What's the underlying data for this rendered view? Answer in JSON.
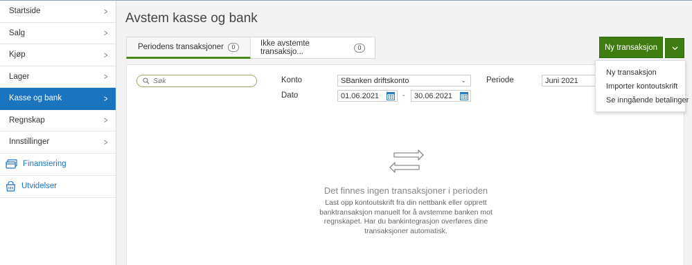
{
  "sidebar": {
    "items": [
      {
        "label": "Startside"
      },
      {
        "label": "Salg"
      },
      {
        "label": "Kjøp"
      },
      {
        "label": "Lager"
      },
      {
        "label": "Kasse og bank"
      },
      {
        "label": "Regnskap"
      },
      {
        "label": "Innstillinger"
      }
    ],
    "special": [
      {
        "label": "Finansiering",
        "icon": "card-stack-icon"
      },
      {
        "label": "Utvidelser",
        "icon": "basket-icon"
      }
    ]
  },
  "page": {
    "title": "Avstem kasse og bank"
  },
  "tabs": [
    {
      "label": "Periodens transaksjoner",
      "count": "0"
    },
    {
      "label": "Ikke avstemte transaksjo...",
      "count": "0"
    }
  ],
  "filters": {
    "search_placeholder": "Søk",
    "konto_label": "Konto",
    "konto_value": "SBanken driftskonto",
    "periode_label": "Periode",
    "periode_value": "Juni 2021",
    "dato_label": "Dato",
    "date_from": "01.06.2021",
    "date_separator": "-",
    "date_to": "30.06.2021"
  },
  "empty_state": {
    "title": "Det finnes ingen transaksjoner i perioden",
    "text": "Last opp kontoutskrift fra din nettbank eller opprett banktransaksjon manuelt for å avstemme banken mot regnskapet. Har du bankintegrasjon overføres dine transaksjoner automatisk."
  },
  "actions": {
    "primary_label": "Ny transaksjon",
    "menu": [
      {
        "label": "Ny transaksjon"
      },
      {
        "label": "Importer kontoutskrift"
      },
      {
        "label": "Se inngående betalinger"
      }
    ]
  },
  "colors": {
    "accent_blue": "#1b74c0",
    "accent_green": "#3f7d12"
  }
}
